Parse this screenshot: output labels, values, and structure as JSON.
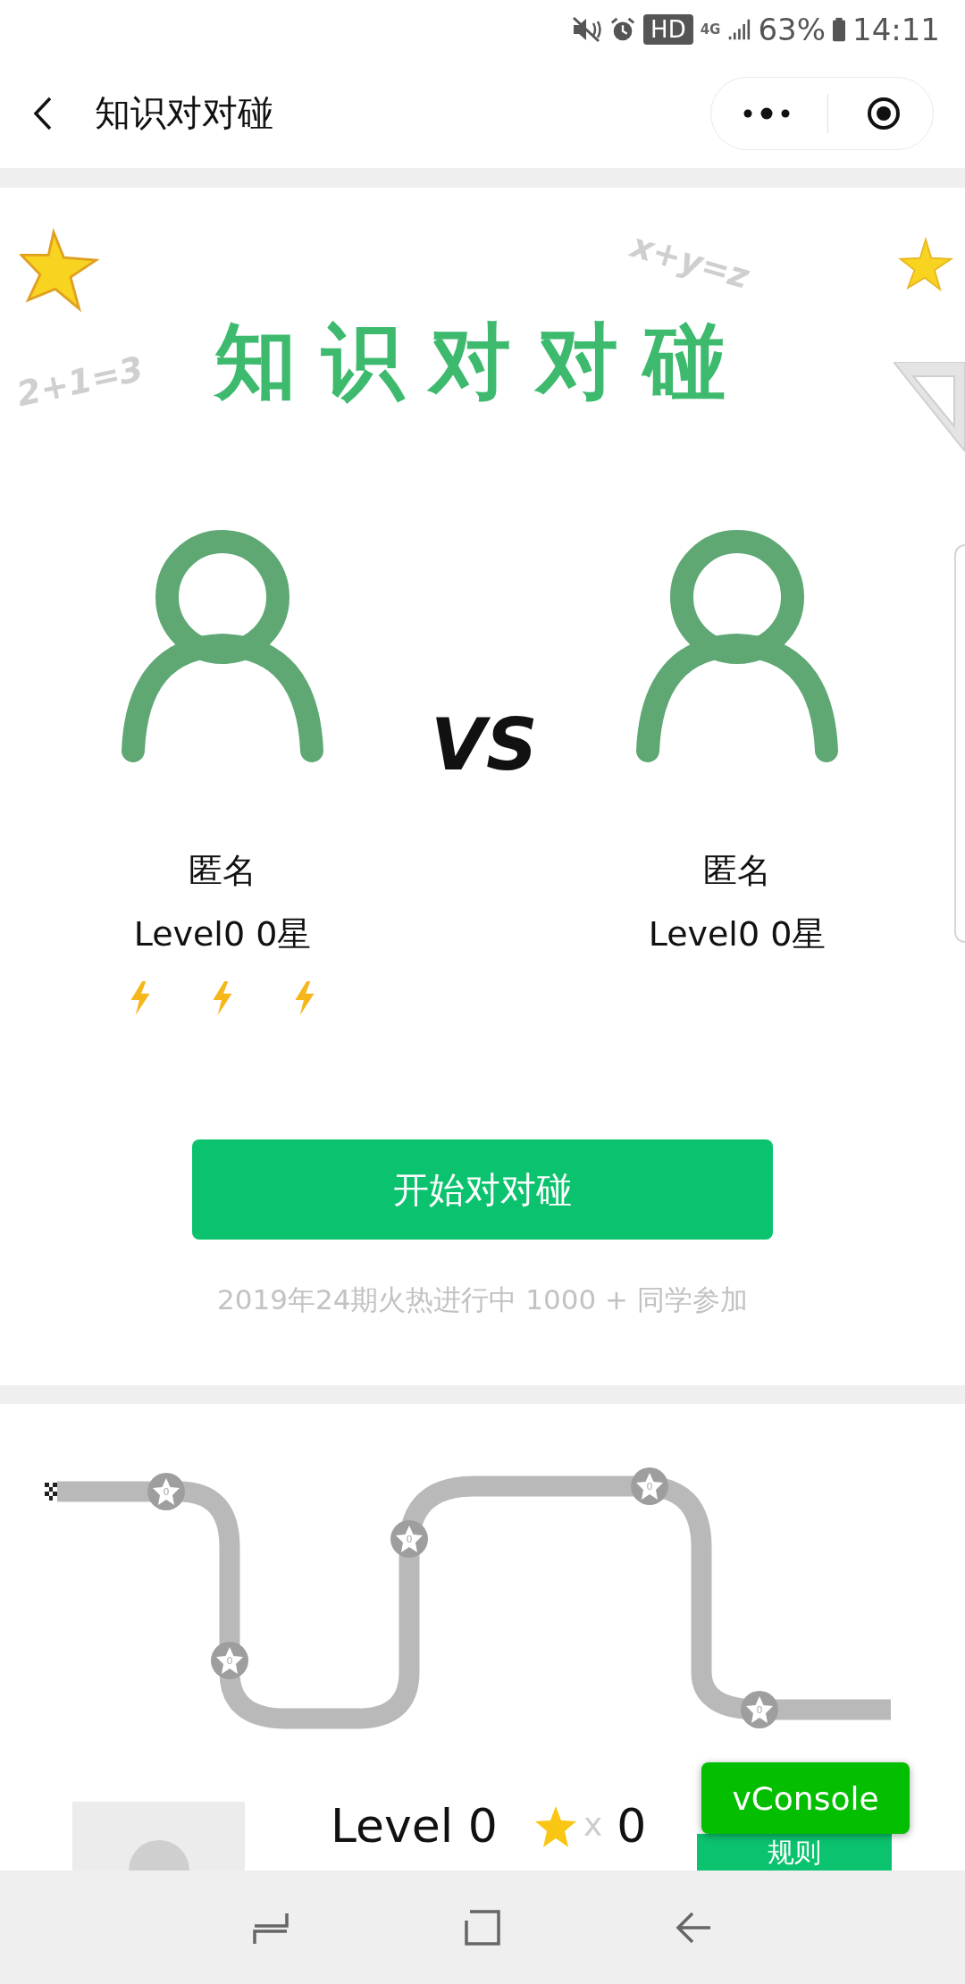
{
  "status_bar": {
    "badge": "HD",
    "network": "4G",
    "battery": "63%",
    "time": "14:11"
  },
  "nav": {
    "title": "知识对对碰"
  },
  "hero": {
    "title": "知识对对碰",
    "doodles": [
      "x+y=z",
      "2+1=3"
    ]
  },
  "players": [
    {
      "name": "匿名",
      "level": "Level0 0星",
      "show_energy": true
    },
    {
      "name": "匿名",
      "level": "Level0 0星",
      "show_energy": false
    }
  ],
  "versus": "VS",
  "start_button": "开始对对碰",
  "subtitle": "2019年24期火热进行中 1000 + 同学参加",
  "path": {
    "nodes": [
      {
        "count": "0"
      },
      {
        "count": "0"
      },
      {
        "count": "0"
      },
      {
        "count": "0"
      },
      {
        "count": "0"
      }
    ]
  },
  "footer": {
    "level": "Level 0",
    "times": "x",
    "star_count": "0",
    "rules_button": "规则"
  },
  "vconsole": "vConsole"
}
